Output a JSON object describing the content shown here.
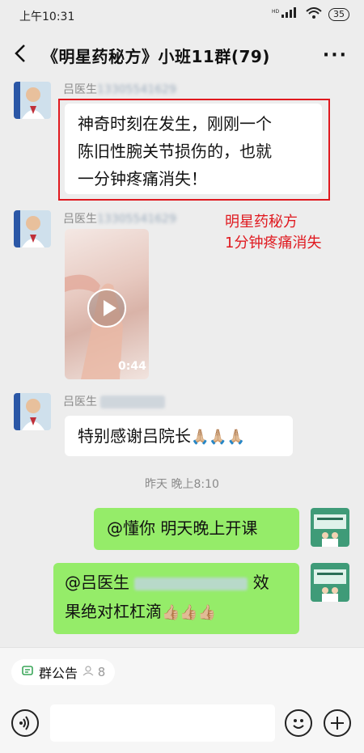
{
  "status": {
    "time": "上午10:31",
    "signal": "HD",
    "battery": "35"
  },
  "nav": {
    "title": "《明星药秘方》小班11群(79)"
  },
  "messages": [
    {
      "sender_name": "吕医生",
      "sender_suffix": "13305541629",
      "text_lines": [
        "神奇时刻在发生，刚刚一个",
        "陈旧性腕关节损伤的，也就",
        "一分钟疼痛消失！"
      ]
    },
    {
      "sender_name": "吕医生",
      "sender_suffix": "13305541629",
      "video_duration": "0:44"
    },
    {
      "sender_name": "吕医生",
      "text": "特别感谢吕院长",
      "emoji": "🙏🏼🙏🏼🙏🏼"
    }
  ],
  "annotation": {
    "line1": "明星药秘方",
    "line2": "1分钟疼痛消失"
  },
  "timestamp": "昨天 晚上8:10",
  "outgoing": [
    {
      "text": "@懂你  明天晚上开课"
    },
    {
      "line1_prefix": "@吕医生",
      "line1_suffix": "效",
      "line2": "果绝对杠杠滴",
      "emoji": "👍🏼👍🏼👍🏼"
    }
  ],
  "bottom": {
    "notice_label": "群公告",
    "notice_count": "8"
  }
}
